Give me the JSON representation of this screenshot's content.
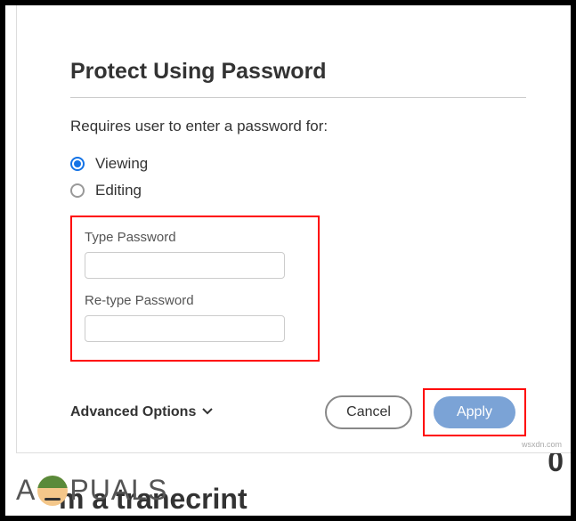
{
  "dialog": {
    "title": "Protect Using Password",
    "subtitle": "Requires user to enter a password for:",
    "radios": {
      "viewing": "Viewing",
      "editing": "Editing"
    },
    "fields": {
      "password_label": "Type Password",
      "retype_label": "Re-type Password"
    },
    "advanced_options": "Advanced Options",
    "buttons": {
      "cancel": "Cancel",
      "apply": "Apply"
    }
  },
  "logo": {
    "prefix": "A",
    "suffix": "PUALS"
  },
  "background": {
    "text3": "0",
    "text4": "m a tranecrint"
  },
  "watermark": "wsxdn.com"
}
